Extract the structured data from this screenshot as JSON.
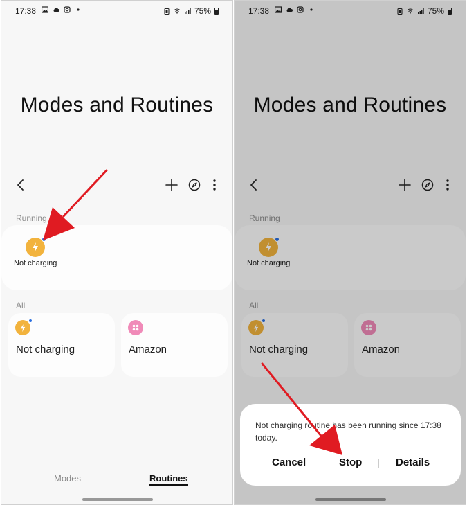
{
  "status": {
    "time": "17:38",
    "battery_percent": "75%"
  },
  "app": {
    "title": "Modes and Routines"
  },
  "icons": {
    "back": "chevron-left-icon",
    "add": "plus-icon",
    "discover": "compass-icon",
    "more": "more-vertical-icon",
    "routine_not_charging": "lightning-icon",
    "routine_amazon": "grid-dots-icon"
  },
  "sections": {
    "running_label": "Running",
    "all_label": "All"
  },
  "running": {
    "items": [
      {
        "label": "Not charging"
      }
    ]
  },
  "routines": {
    "items": [
      {
        "label": "Not charging"
      },
      {
        "label": "Amazon"
      }
    ]
  },
  "bottom_nav": {
    "modes": "Modes",
    "routines": "Routines",
    "selected": "Routines"
  },
  "dialog": {
    "message": "Not charging routine has been running since 17:38 today.",
    "cancel": "Cancel",
    "stop": "Stop",
    "details": "Details"
  },
  "colors": {
    "accent_red_arrow": "#e01b22",
    "routine_orange": "#f2b33d",
    "routine_pink": "#f08ab8",
    "running_dot": "#2a6fe0"
  }
}
